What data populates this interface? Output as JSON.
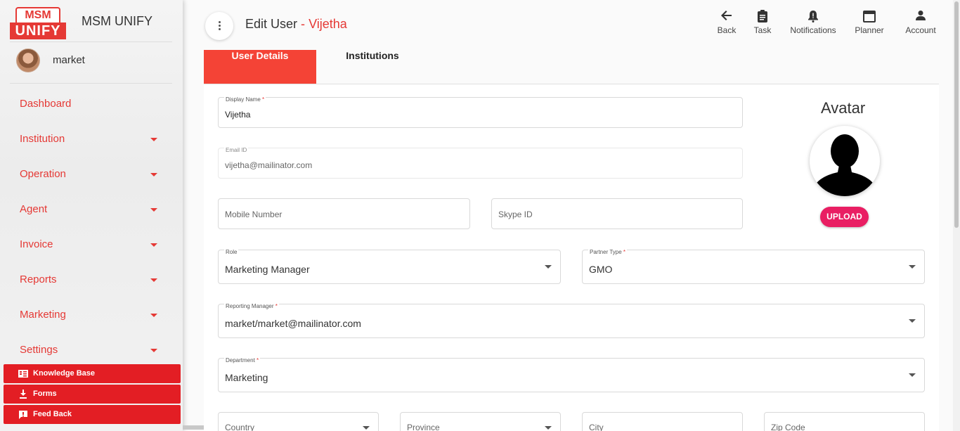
{
  "brand": {
    "logo_top": "MSM",
    "logo_bottom": "UNIFY",
    "name": "MSM UNIFY"
  },
  "user": {
    "name": "market"
  },
  "nav": [
    {
      "label": "Dashboard",
      "has_caret": false
    },
    {
      "label": "Institution",
      "has_caret": true
    },
    {
      "label": "Operation",
      "has_caret": true
    },
    {
      "label": "Agent",
      "has_caret": true
    },
    {
      "label": "Invoice",
      "has_caret": true
    },
    {
      "label": "Reports",
      "has_caret": true
    },
    {
      "label": "Marketing",
      "has_caret": true
    },
    {
      "label": "Settings",
      "has_caret": true
    }
  ],
  "quick_links": {
    "knowledge_base": "Knowledge Base",
    "forms": "Forms",
    "feedback": "Feed Back"
  },
  "header": {
    "title": "Edit User",
    "separator": "-",
    "subject": "Vijetha",
    "actions": {
      "back": "Back",
      "task": "Task",
      "notifications": "Notifications",
      "planner": "Planner",
      "account": "Account"
    }
  },
  "tabs": {
    "user_details": "User Details",
    "institutions": "Institutions"
  },
  "form": {
    "display_name": {
      "label": "Display Name",
      "required_mark": "*",
      "value": "Vijetha"
    },
    "email": {
      "label": "Email ID",
      "value": "vijetha@mailinator.com"
    },
    "mobile": {
      "placeholder": "Mobile Number"
    },
    "skype": {
      "placeholder": "Skype ID"
    },
    "role": {
      "label": "Role",
      "value": "Marketing Manager"
    },
    "partner_type": {
      "label": "Partner Type",
      "required_mark": "*",
      "value": "GMO"
    },
    "reporting_manager": {
      "label": "Reporting Manager",
      "required_mark": "*",
      "value": "market/market@mailinator.com"
    },
    "department": {
      "label": "Department",
      "required_mark": "*",
      "value": "Marketing"
    },
    "country": {
      "placeholder": "Country"
    },
    "province": {
      "placeholder": "Province"
    },
    "city": {
      "placeholder": "City"
    },
    "zip": {
      "placeholder": "Zip Code"
    }
  },
  "avatar": {
    "title": "Avatar",
    "upload_label": "UPLOAD"
  },
  "colors": {
    "accent": "#e53935",
    "tab_active": "#f44336",
    "upload": "#e91e63",
    "quick_link_bg": "#e31e24"
  },
  "icons": {
    "back": "arrow-left-icon",
    "task": "clipboard-icon",
    "notifications": "bell-icon",
    "planner": "calendar-icon",
    "account": "person-icon",
    "knowledge_base": "book-icon",
    "forms": "download-icon",
    "feedback": "feedback-icon"
  }
}
